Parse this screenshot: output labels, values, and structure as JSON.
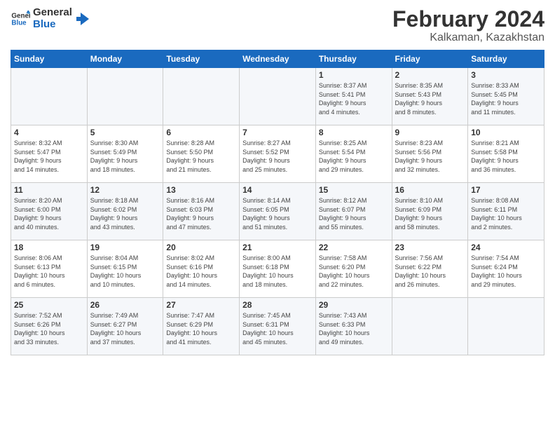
{
  "logo": {
    "line1": "General",
    "line2": "Blue"
  },
  "title": "February 2024",
  "subtitle": "Kalkaman, Kazakhstan",
  "weekdays": [
    "Sunday",
    "Monday",
    "Tuesday",
    "Wednesday",
    "Thursday",
    "Friday",
    "Saturday"
  ],
  "weeks": [
    [
      {
        "day": "",
        "info": ""
      },
      {
        "day": "",
        "info": ""
      },
      {
        "day": "",
        "info": ""
      },
      {
        "day": "",
        "info": ""
      },
      {
        "day": "1",
        "info": "Sunrise: 8:37 AM\nSunset: 5:41 PM\nDaylight: 9 hours\nand 4 minutes."
      },
      {
        "day": "2",
        "info": "Sunrise: 8:35 AM\nSunset: 5:43 PM\nDaylight: 9 hours\nand 8 minutes."
      },
      {
        "day": "3",
        "info": "Sunrise: 8:33 AM\nSunset: 5:45 PM\nDaylight: 9 hours\nand 11 minutes."
      }
    ],
    [
      {
        "day": "4",
        "info": "Sunrise: 8:32 AM\nSunset: 5:47 PM\nDaylight: 9 hours\nand 14 minutes."
      },
      {
        "day": "5",
        "info": "Sunrise: 8:30 AM\nSunset: 5:49 PM\nDaylight: 9 hours\nand 18 minutes."
      },
      {
        "day": "6",
        "info": "Sunrise: 8:28 AM\nSunset: 5:50 PM\nDaylight: 9 hours\nand 21 minutes."
      },
      {
        "day": "7",
        "info": "Sunrise: 8:27 AM\nSunset: 5:52 PM\nDaylight: 9 hours\nand 25 minutes."
      },
      {
        "day": "8",
        "info": "Sunrise: 8:25 AM\nSunset: 5:54 PM\nDaylight: 9 hours\nand 29 minutes."
      },
      {
        "day": "9",
        "info": "Sunrise: 8:23 AM\nSunset: 5:56 PM\nDaylight: 9 hours\nand 32 minutes."
      },
      {
        "day": "10",
        "info": "Sunrise: 8:21 AM\nSunset: 5:58 PM\nDaylight: 9 hours\nand 36 minutes."
      }
    ],
    [
      {
        "day": "11",
        "info": "Sunrise: 8:20 AM\nSunset: 6:00 PM\nDaylight: 9 hours\nand 40 minutes."
      },
      {
        "day": "12",
        "info": "Sunrise: 8:18 AM\nSunset: 6:02 PM\nDaylight: 9 hours\nand 43 minutes."
      },
      {
        "day": "13",
        "info": "Sunrise: 8:16 AM\nSunset: 6:03 PM\nDaylight: 9 hours\nand 47 minutes."
      },
      {
        "day": "14",
        "info": "Sunrise: 8:14 AM\nSunset: 6:05 PM\nDaylight: 9 hours\nand 51 minutes."
      },
      {
        "day": "15",
        "info": "Sunrise: 8:12 AM\nSunset: 6:07 PM\nDaylight: 9 hours\nand 55 minutes."
      },
      {
        "day": "16",
        "info": "Sunrise: 8:10 AM\nSunset: 6:09 PM\nDaylight: 9 hours\nand 58 minutes."
      },
      {
        "day": "17",
        "info": "Sunrise: 8:08 AM\nSunset: 6:11 PM\nDaylight: 10 hours\nand 2 minutes."
      }
    ],
    [
      {
        "day": "18",
        "info": "Sunrise: 8:06 AM\nSunset: 6:13 PM\nDaylight: 10 hours\nand 6 minutes."
      },
      {
        "day": "19",
        "info": "Sunrise: 8:04 AM\nSunset: 6:15 PM\nDaylight: 10 hours\nand 10 minutes."
      },
      {
        "day": "20",
        "info": "Sunrise: 8:02 AM\nSunset: 6:16 PM\nDaylight: 10 hours\nand 14 minutes."
      },
      {
        "day": "21",
        "info": "Sunrise: 8:00 AM\nSunset: 6:18 PM\nDaylight: 10 hours\nand 18 minutes."
      },
      {
        "day": "22",
        "info": "Sunrise: 7:58 AM\nSunset: 6:20 PM\nDaylight: 10 hours\nand 22 minutes."
      },
      {
        "day": "23",
        "info": "Sunrise: 7:56 AM\nSunset: 6:22 PM\nDaylight: 10 hours\nand 26 minutes."
      },
      {
        "day": "24",
        "info": "Sunrise: 7:54 AM\nSunset: 6:24 PM\nDaylight: 10 hours\nand 29 minutes."
      }
    ],
    [
      {
        "day": "25",
        "info": "Sunrise: 7:52 AM\nSunset: 6:26 PM\nDaylight: 10 hours\nand 33 minutes."
      },
      {
        "day": "26",
        "info": "Sunrise: 7:49 AM\nSunset: 6:27 PM\nDaylight: 10 hours\nand 37 minutes."
      },
      {
        "day": "27",
        "info": "Sunrise: 7:47 AM\nSunset: 6:29 PM\nDaylight: 10 hours\nand 41 minutes."
      },
      {
        "day": "28",
        "info": "Sunrise: 7:45 AM\nSunset: 6:31 PM\nDaylight: 10 hours\nand 45 minutes."
      },
      {
        "day": "29",
        "info": "Sunrise: 7:43 AM\nSunset: 6:33 PM\nDaylight: 10 hours\nand 49 minutes."
      },
      {
        "day": "",
        "info": ""
      },
      {
        "day": "",
        "info": ""
      }
    ]
  ]
}
